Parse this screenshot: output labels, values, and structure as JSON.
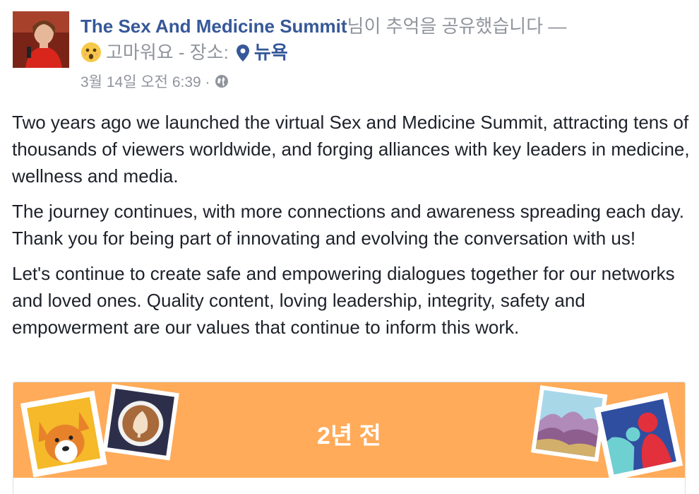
{
  "post": {
    "page_name": "The Sex And Medicine Summit",
    "action_text": "님이 추억을 공유했습니다 —",
    "feeling": "고마워요",
    "location_prefix": "- 장소:",
    "location": "뉴욕",
    "timestamp": "3월 14일 오전 6:39 ·",
    "privacy_icon": "globe-icon",
    "feeling_icon": "grateful-face-emoji",
    "location_icon": "map-pin-icon",
    "paragraphs": [
      "Two years ago we launched the virtual Sex and Medicine Summit, attracting tens of thousands of viewers worldwide, and forging alliances with key leaders in medicine, wellness and media.",
      "The journey continues, with more connections and awareness spreading each day. Thank you for being part of innovating and evolving the conversation with us!",
      "Let's continue to create safe and empowering dialogues together for our networks and loved ones. Quality content, loving leadership, integrity, safety and empowerment are our values that continue to inform this work."
    ]
  },
  "memory": {
    "title": "2년 전",
    "banner_color": "#ffab5a"
  },
  "colors": {
    "link": "#365899",
    "meta": "#90949c",
    "text": "#1d2129"
  }
}
